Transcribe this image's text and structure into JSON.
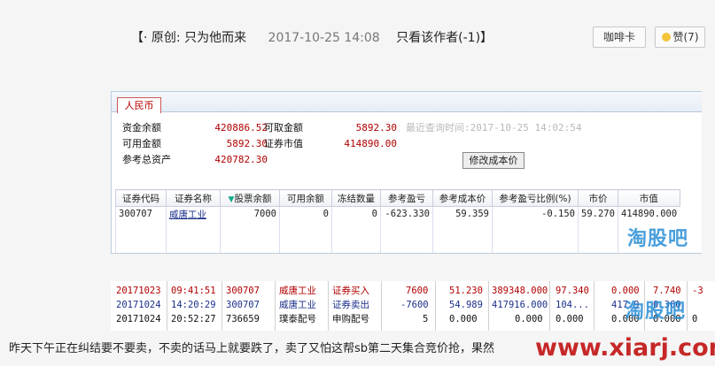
{
  "post": {
    "tag": "【·",
    "tag_close": "】",
    "title": "原创: 只为他而来",
    "date": "2017-10-25 14:08",
    "author_filter": "只看该作者(-1)"
  },
  "buttons": {
    "cafe": "咖啡卡",
    "like": "赞(7)"
  },
  "screenshot1": {
    "tab": "人民币",
    "summary_left": [
      {
        "label": "资金余额",
        "value": "420886.52"
      },
      {
        "label": "可用金额",
        "value": "5892.30"
      },
      {
        "label": "参考总资产",
        "value": "420782.30"
      }
    ],
    "summary_right": [
      {
        "label": "可取金额",
        "value": "5892.30"
      },
      {
        "label": "证券市值",
        "value": "414890.00"
      }
    ],
    "query_time": "最近查询时间:2017-10-25 14:02:54",
    "modify_cost": "修改成本价",
    "columns": [
      "证券代码",
      "证券名称",
      "股票余额",
      "可用余额",
      "冻结数量",
      "参考盈亏",
      "参考成本价",
      "参考盈亏比例(%)",
      "市价",
      "市值"
    ],
    "rows": [
      [
        "300707",
        "威唐工业",
        "7000",
        "0",
        "0",
        "-623.330",
        "59.359",
        "-0.150",
        "59.270",
        "414890.000"
      ]
    ]
  },
  "screenshot2": {
    "rows": [
      {
        "cells": [
          "20171023",
          "09:41:51",
          "300707",
          "威唐工业",
          "证券买入",
          "7600",
          "51.230",
          "389348.000",
          "97.340",
          "0.000",
          "7.740",
          "-3"
        ],
        "color": "red"
      },
      {
        "cells": [
          "20171024",
          "14:20:29",
          "300707",
          "威唐工业",
          "证券卖出",
          "-7600",
          "54.989",
          "417916.000",
          "104...",
          "417.9",
          "0.360",
          ""
        ],
        "color": "blue"
      },
      {
        "cells": [
          "20171024",
          "20:52:27",
          "736659",
          "璞泰配号",
          "申购配号",
          "5",
          "0.000",
          "0.000",
          "0.000",
          "0.000",
          "0.000",
          "0"
        ],
        "color": "black"
      }
    ]
  },
  "caption": "昨天下午正在纠结要不要卖，不卖的话马上就要跌了，卖了又怕这帮sb第二天集合竞价抢，果然",
  "watermarks": {
    "taoguba": "淘股吧",
    "url": "www.xiarj.com"
  }
}
